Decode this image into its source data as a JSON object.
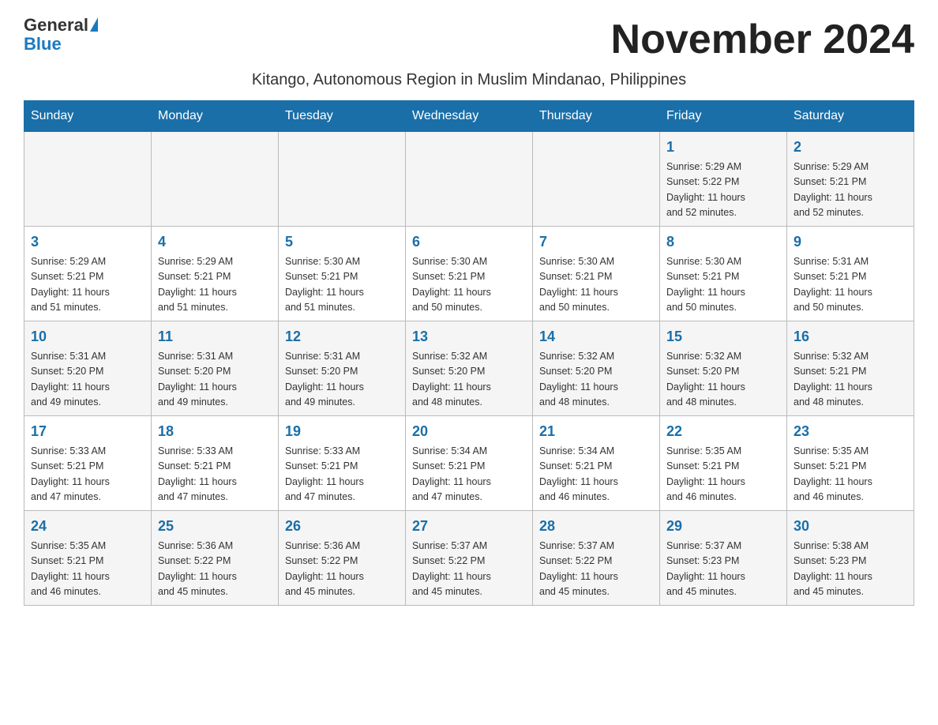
{
  "header": {
    "logo_general": "General",
    "logo_blue": "Blue",
    "month_title": "November 2024",
    "subtitle": "Kitango, Autonomous Region in Muslim Mindanao, Philippines"
  },
  "days_of_week": [
    "Sunday",
    "Monday",
    "Tuesday",
    "Wednesday",
    "Thursday",
    "Friday",
    "Saturday"
  ],
  "weeks": [
    {
      "days": [
        {
          "number": "",
          "info": ""
        },
        {
          "number": "",
          "info": ""
        },
        {
          "number": "",
          "info": ""
        },
        {
          "number": "",
          "info": ""
        },
        {
          "number": "",
          "info": ""
        },
        {
          "number": "1",
          "info": "Sunrise: 5:29 AM\nSunset: 5:22 PM\nDaylight: 11 hours\nand 52 minutes."
        },
        {
          "number": "2",
          "info": "Sunrise: 5:29 AM\nSunset: 5:21 PM\nDaylight: 11 hours\nand 52 minutes."
        }
      ]
    },
    {
      "days": [
        {
          "number": "3",
          "info": "Sunrise: 5:29 AM\nSunset: 5:21 PM\nDaylight: 11 hours\nand 51 minutes."
        },
        {
          "number": "4",
          "info": "Sunrise: 5:29 AM\nSunset: 5:21 PM\nDaylight: 11 hours\nand 51 minutes."
        },
        {
          "number": "5",
          "info": "Sunrise: 5:30 AM\nSunset: 5:21 PM\nDaylight: 11 hours\nand 51 minutes."
        },
        {
          "number": "6",
          "info": "Sunrise: 5:30 AM\nSunset: 5:21 PM\nDaylight: 11 hours\nand 50 minutes."
        },
        {
          "number": "7",
          "info": "Sunrise: 5:30 AM\nSunset: 5:21 PM\nDaylight: 11 hours\nand 50 minutes."
        },
        {
          "number": "8",
          "info": "Sunrise: 5:30 AM\nSunset: 5:21 PM\nDaylight: 11 hours\nand 50 minutes."
        },
        {
          "number": "9",
          "info": "Sunrise: 5:31 AM\nSunset: 5:21 PM\nDaylight: 11 hours\nand 50 minutes."
        }
      ]
    },
    {
      "days": [
        {
          "number": "10",
          "info": "Sunrise: 5:31 AM\nSunset: 5:20 PM\nDaylight: 11 hours\nand 49 minutes."
        },
        {
          "number": "11",
          "info": "Sunrise: 5:31 AM\nSunset: 5:20 PM\nDaylight: 11 hours\nand 49 minutes."
        },
        {
          "number": "12",
          "info": "Sunrise: 5:31 AM\nSunset: 5:20 PM\nDaylight: 11 hours\nand 49 minutes."
        },
        {
          "number": "13",
          "info": "Sunrise: 5:32 AM\nSunset: 5:20 PM\nDaylight: 11 hours\nand 48 minutes."
        },
        {
          "number": "14",
          "info": "Sunrise: 5:32 AM\nSunset: 5:20 PM\nDaylight: 11 hours\nand 48 minutes."
        },
        {
          "number": "15",
          "info": "Sunrise: 5:32 AM\nSunset: 5:20 PM\nDaylight: 11 hours\nand 48 minutes."
        },
        {
          "number": "16",
          "info": "Sunrise: 5:32 AM\nSunset: 5:21 PM\nDaylight: 11 hours\nand 48 minutes."
        }
      ]
    },
    {
      "days": [
        {
          "number": "17",
          "info": "Sunrise: 5:33 AM\nSunset: 5:21 PM\nDaylight: 11 hours\nand 47 minutes."
        },
        {
          "number": "18",
          "info": "Sunrise: 5:33 AM\nSunset: 5:21 PM\nDaylight: 11 hours\nand 47 minutes."
        },
        {
          "number": "19",
          "info": "Sunrise: 5:33 AM\nSunset: 5:21 PM\nDaylight: 11 hours\nand 47 minutes."
        },
        {
          "number": "20",
          "info": "Sunrise: 5:34 AM\nSunset: 5:21 PM\nDaylight: 11 hours\nand 47 minutes."
        },
        {
          "number": "21",
          "info": "Sunrise: 5:34 AM\nSunset: 5:21 PM\nDaylight: 11 hours\nand 46 minutes."
        },
        {
          "number": "22",
          "info": "Sunrise: 5:35 AM\nSunset: 5:21 PM\nDaylight: 11 hours\nand 46 minutes."
        },
        {
          "number": "23",
          "info": "Sunrise: 5:35 AM\nSunset: 5:21 PM\nDaylight: 11 hours\nand 46 minutes."
        }
      ]
    },
    {
      "days": [
        {
          "number": "24",
          "info": "Sunrise: 5:35 AM\nSunset: 5:21 PM\nDaylight: 11 hours\nand 46 minutes."
        },
        {
          "number": "25",
          "info": "Sunrise: 5:36 AM\nSunset: 5:22 PM\nDaylight: 11 hours\nand 45 minutes."
        },
        {
          "number": "26",
          "info": "Sunrise: 5:36 AM\nSunset: 5:22 PM\nDaylight: 11 hours\nand 45 minutes."
        },
        {
          "number": "27",
          "info": "Sunrise: 5:37 AM\nSunset: 5:22 PM\nDaylight: 11 hours\nand 45 minutes."
        },
        {
          "number": "28",
          "info": "Sunrise: 5:37 AM\nSunset: 5:22 PM\nDaylight: 11 hours\nand 45 minutes."
        },
        {
          "number": "29",
          "info": "Sunrise: 5:37 AM\nSunset: 5:23 PM\nDaylight: 11 hours\nand 45 minutes."
        },
        {
          "number": "30",
          "info": "Sunrise: 5:38 AM\nSunset: 5:23 PM\nDaylight: 11 hours\nand 45 minutes."
        }
      ]
    }
  ]
}
